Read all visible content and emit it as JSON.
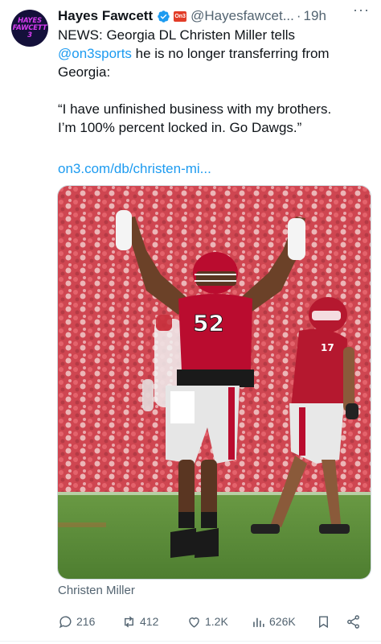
{
  "author": {
    "avatar_text": "HAYES\nFAWCETT\n3",
    "name": "Hayes Fawcett",
    "handle": "@Hayesfawcet...",
    "separator": "·",
    "time": "19h",
    "verified_icon": "verified-badge-icon",
    "affiliation_icon": "on3-logo-icon",
    "affiliation_text": "On3"
  },
  "more_label": "···",
  "tweet": {
    "line1_a": "NEWS: Georgia DL Christen Miller tells",
    "mention": "@on3sports",
    "line2_b": " he is no longer transferring from",
    "line3": "Georgia:",
    "quote_line1": "“I have unfinished business with my brothers.",
    "quote_line2": "I’m 100% percent locked in. Go Dawgs.”",
    "link": "on3.com/db/christen-mi..."
  },
  "media": {
    "caption": "Christen Miller",
    "jersey_main": "52",
    "jersey_back": "17"
  },
  "actions": {
    "replies": "216",
    "reposts": "412",
    "likes": "1.2K",
    "views": "626K"
  },
  "colors": {
    "accent": "#1d9bf0",
    "muted": "#536471",
    "georgia_red": "#ba0c2f"
  }
}
